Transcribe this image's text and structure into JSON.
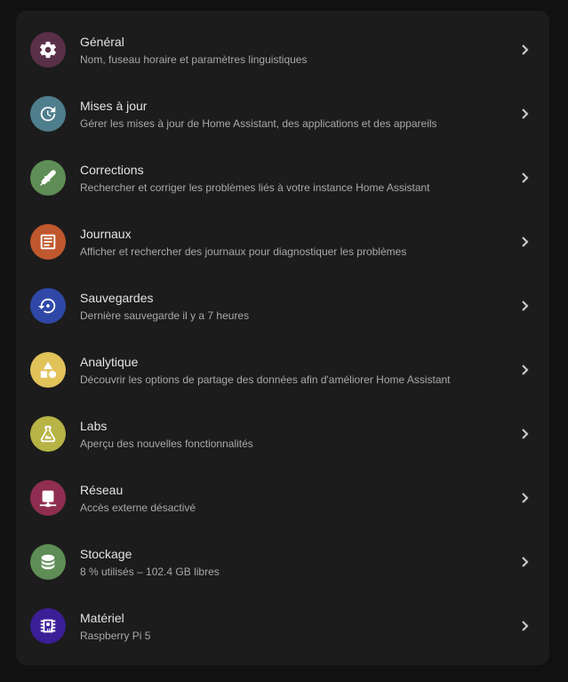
{
  "items": [
    {
      "title": "Général",
      "subtitle": "Nom, fuseau horaire et paramètres linguistiques",
      "icon": "gear-icon",
      "color": "#5a2f48"
    },
    {
      "title": "Mises à jour",
      "subtitle": "Gérer les mises à jour de Home Assistant, des applications et des appareils",
      "icon": "update-clock-icon",
      "color": "#4f7e8c"
    },
    {
      "title": "Corrections",
      "subtitle": "Rechercher et corriger les problèmes liés à votre instance Home Assistant",
      "icon": "wrench-icon",
      "color": "#5e8d55"
    },
    {
      "title": "Journaux",
      "subtitle": "Afficher et rechercher des journaux pour diagnostiquer les problèmes",
      "icon": "document-icon",
      "color": "#c0582d"
    },
    {
      "title": "Sauvegardes",
      "subtitle": "Dernière sauvegarde il y a 7 heures",
      "icon": "backup-restore-icon",
      "color": "#2f48a8"
    },
    {
      "title": "Analytique",
      "subtitle": "Découvrir les options de partage des données afin d'améliorer Home Assistant",
      "icon": "shapes-icon",
      "color": "#e2c35a"
    },
    {
      "title": "Labs",
      "subtitle": "Aperçu des nouvelles fonctionnalités",
      "icon": "flask-icon",
      "color": "#b7b344"
    },
    {
      "title": "Réseau",
      "subtitle": "Accès externe désactivé",
      "icon": "network-icon",
      "color": "#8f2e50"
    },
    {
      "title": "Stockage",
      "subtitle": "8 % utilisés – 102.4 GB libres",
      "icon": "database-icon",
      "color": "#5e8d55"
    },
    {
      "title": "Matériel",
      "subtitle": "Raspberry Pi 5",
      "icon": "chip-icon",
      "color": "#3a1f96"
    }
  ]
}
